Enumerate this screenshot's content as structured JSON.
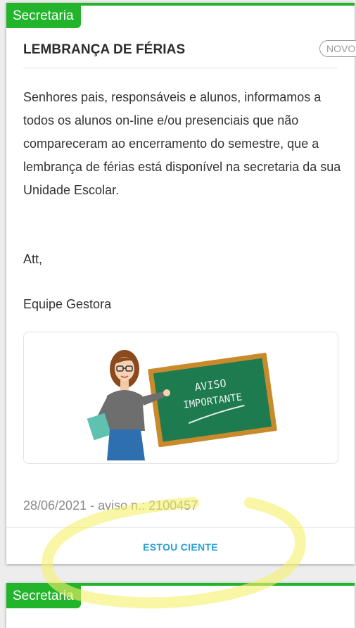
{
  "cards": [
    {
      "tag": "Secretaria",
      "title": "LEMBRANÇA DE FÉRIAS",
      "badge": "NOVO",
      "body": "Senhores pais, responsáveis e alunos, informamos a todos os alunos on-line e/ou presenciais que não compareceram ao encerramento do semestre, que a lembrança de férias está disponível na secretaria da sua Unidade Escolar.",
      "signature_line1": "Att,",
      "signature_line2": "Equipe Gestora",
      "image": {
        "board_text_line1": "AVISO",
        "board_text_line2": "IMPORTANTE"
      },
      "meta": "28/06/2021 - aviso n.: 2100457",
      "action_label": "ESTOU CIENTE"
    },
    {
      "tag": "Secretaria"
    }
  ],
  "colors": {
    "accent_green": "#22b52b",
    "action_blue": "#2a9fd6",
    "highlight_yellow": "#f5f06a"
  }
}
